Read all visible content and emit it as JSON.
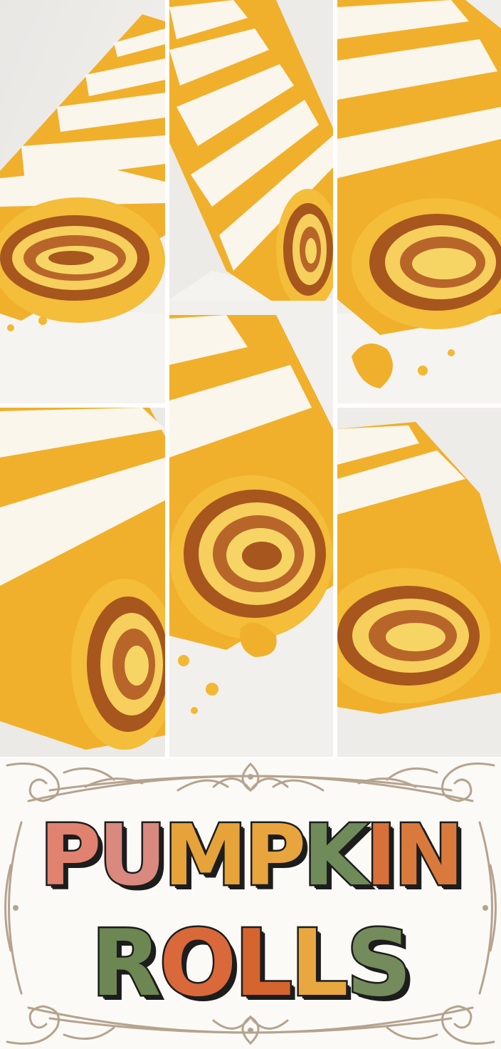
{
  "pin": {
    "title_words": [
      {
        "word": "PUMPKIN",
        "letters": [
          {
            "ch": "P",
            "color": "#e0826f"
          },
          {
            "ch": "U",
            "color": "#d9897e"
          },
          {
            "ch": "M",
            "color": "#e5a33a"
          },
          {
            "ch": "P",
            "color": "#e8a43d"
          },
          {
            "ch": "K",
            "color": "#6f8b5a"
          },
          {
            "ch": "I",
            "color": "#d9703a"
          },
          {
            "ch": "N",
            "color": "#d97a3c"
          }
        ]
      },
      {
        "word": "ROLLS",
        "letters": [
          {
            "ch": "R",
            "color": "#6d8753"
          },
          {
            "ch": "O",
            "color": "#d9683a"
          },
          {
            "ch": "L",
            "color": "#d6642f"
          },
          {
            "ch": "L",
            "color": "#e9a73f"
          },
          {
            "ch": "S",
            "color": "#748c5c"
          }
        ]
      }
    ],
    "ornament_color": "#b5a38e",
    "photos": [
      {
        "name": "photo-roll-left-top"
      },
      {
        "name": "photo-roll-middle-top"
      },
      {
        "name": "photo-roll-right-top"
      },
      {
        "name": "photo-roll-left-bottom"
      },
      {
        "name": "photo-roll-middle-bottom"
      },
      {
        "name": "photo-roll-right-bottom"
      }
    ]
  }
}
